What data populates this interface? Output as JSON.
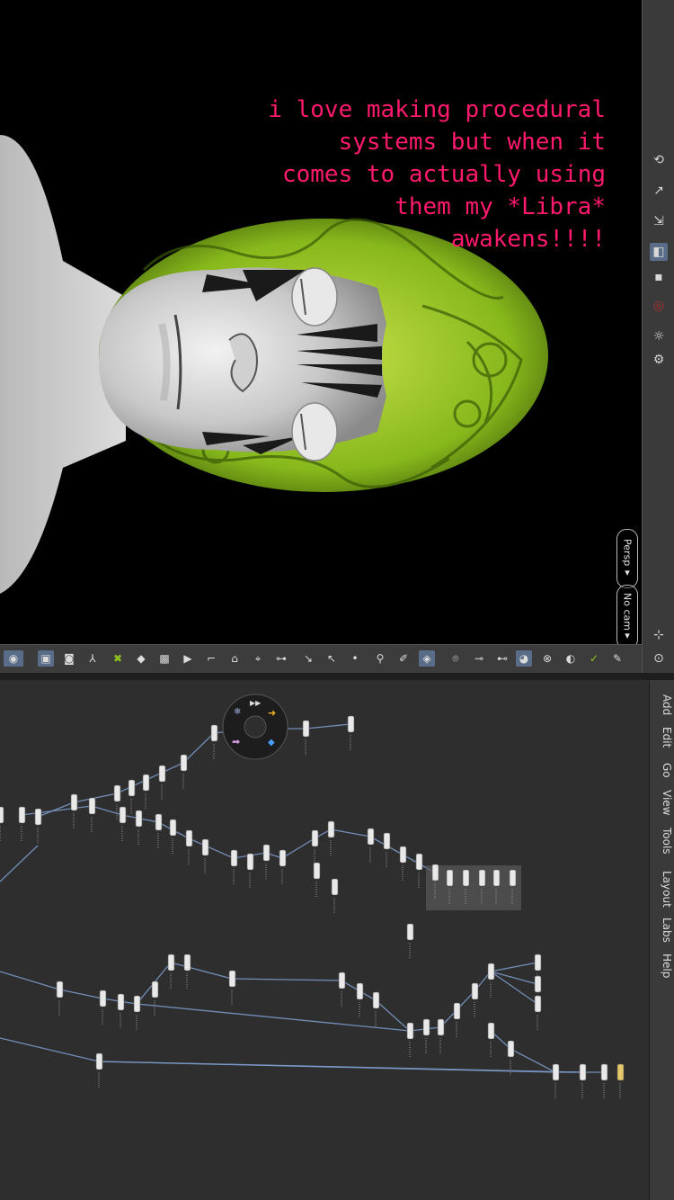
{
  "caption": "i love making procedural\nsystems but when it\ncomes to actually using\nthem my *Libra*\nawakens!!!!",
  "viewport": {
    "camera_label": "Persp",
    "camera_dropdown": "▾",
    "cam_label": "No cam",
    "cam_dropdown": "▾"
  },
  "network_menu": [
    "Add",
    "Edit",
    "Go",
    "View",
    "Tools",
    "Layout",
    "Labs",
    "Help"
  ],
  "colors": {
    "caption": "#ff1a6e",
    "hair": "#8fc31f",
    "skin": "#cfcfcf",
    "network_bg": "#2e2e2e",
    "wire": "#7f9fd0"
  },
  "right_strip_icons": [
    "rotate-icon",
    "translate-icon",
    "scale-icon",
    "snap-icon",
    "display-icon",
    "record-icon",
    "lighting-icon",
    "settings-icon"
  ],
  "toolbar_icons": [
    "select-icon",
    "view-icon",
    "ghost-icon",
    "axis-icon",
    "component-icon",
    "point-icon",
    "edge-icon",
    "primitive-icon",
    "arrow-icon",
    "lasso-icon",
    "brush-icon",
    "paint-icon",
    "handle-icon",
    "pose-icon",
    "pick-icon",
    "dot-icon",
    "snap-grid-icon",
    "snap-curve-icon",
    "snap-point-icon",
    "camera-icon",
    "light-icon",
    "flipbook-icon",
    "render-icon",
    "shade-icon",
    "visibility-icon",
    "pen-icon",
    "bulb-icon"
  ]
}
